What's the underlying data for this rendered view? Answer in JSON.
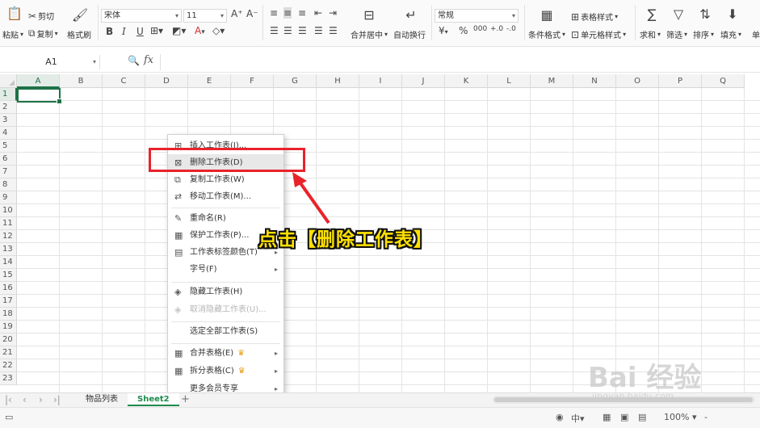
{
  "ribbon": {
    "paste": "粘贴",
    "cut": "剪切",
    "copy": "复制",
    "format_painter": "格式刷",
    "font_name": "宋体",
    "font_size": "11",
    "font_grow": "A⁺",
    "font_shrink": "A⁻",
    "bold": "B",
    "italic": "I",
    "underline": "U",
    "merge_center": "合并居中",
    "wrap_text": "自动换行",
    "number_format": "常规",
    "currency": "¥",
    "percent": "%",
    "thousands": "000",
    "dec_inc": "+.0",
    "dec_dec": "-.0",
    "conditional_format": "条件格式",
    "table_style": "表格样式",
    "cell_style": "单元格样式",
    "sum": "求和",
    "filter": "筛选",
    "sort": "排序",
    "fill": "填充",
    "more": "单"
  },
  "formula_bar": {
    "cell_ref": "A1",
    "fx": "fx"
  },
  "grid": {
    "columns": [
      "A",
      "B",
      "C",
      "D",
      "E",
      "F",
      "G",
      "H",
      "I",
      "J",
      "K",
      "L",
      "M",
      "N",
      "O",
      "P",
      "Q"
    ],
    "rows": [
      "1",
      "2",
      "3",
      "4",
      "5",
      "6",
      "7",
      "8",
      "9",
      "10",
      "11",
      "12",
      "13",
      "14",
      "15",
      "16",
      "17",
      "18",
      "19",
      "20",
      "21",
      "22",
      "23"
    ]
  },
  "context_menu": {
    "items": [
      {
        "label": "插入工作表(I)...",
        "icon": "insert-sheet-icon",
        "glyph": "⊞"
      },
      {
        "label": "删除工作表(D)",
        "icon": "delete-sheet-icon",
        "glyph": "⊠"
      },
      {
        "label": "复制工作表(W)",
        "icon": "copy-sheet-icon",
        "glyph": "⧉"
      },
      {
        "label": "移动工作表(M)...",
        "icon": "move-sheet-icon",
        "glyph": "⇄"
      },
      {
        "label": "重命名(R)",
        "icon": "rename-icon",
        "glyph": "✎"
      },
      {
        "label": "保护工作表(P)...",
        "icon": "protect-sheet-icon",
        "glyph": "▦"
      },
      {
        "label": "工作表标签颜色(T)",
        "icon": "tab-color-icon",
        "glyph": "▤"
      },
      {
        "label": "字号(F)",
        "icon": "",
        "glyph": ""
      },
      {
        "label": "隐藏工作表(H)",
        "icon": "hide-sheet-icon",
        "glyph": "◈"
      },
      {
        "label": "取消隐藏工作表(U)...",
        "icon": "unhide-sheet-icon",
        "glyph": "◈"
      },
      {
        "label": "选定全部工作表(S)",
        "icon": "",
        "glyph": ""
      },
      {
        "label": "合并表格(E)",
        "icon": "merge-table-icon",
        "glyph": "▦"
      },
      {
        "label": "拆分表格(C)",
        "icon": "split-table-icon",
        "glyph": "▦"
      },
      {
        "label": "更多会员专享",
        "icon": "",
        "glyph": ""
      }
    ]
  },
  "sheets": {
    "tabs": [
      "物品列表",
      "Sheet2"
    ],
    "active": "Sheet2",
    "add": "+"
  },
  "status": {
    "ime": "中",
    "zoom": "100%",
    "zoom_minus": "-",
    "zoom_plus": "+"
  },
  "annotation": {
    "text": "点击【删除工作表】"
  },
  "watermark": {
    "brand": "Bai 经验",
    "url": "jingyan.baidu.com"
  },
  "colors": {
    "accent": "#1e7145",
    "tab_active": "#1e8a4c",
    "highlight": "#e8232b",
    "annotation_text": "#ffe100",
    "crown": "#e6a01f"
  }
}
